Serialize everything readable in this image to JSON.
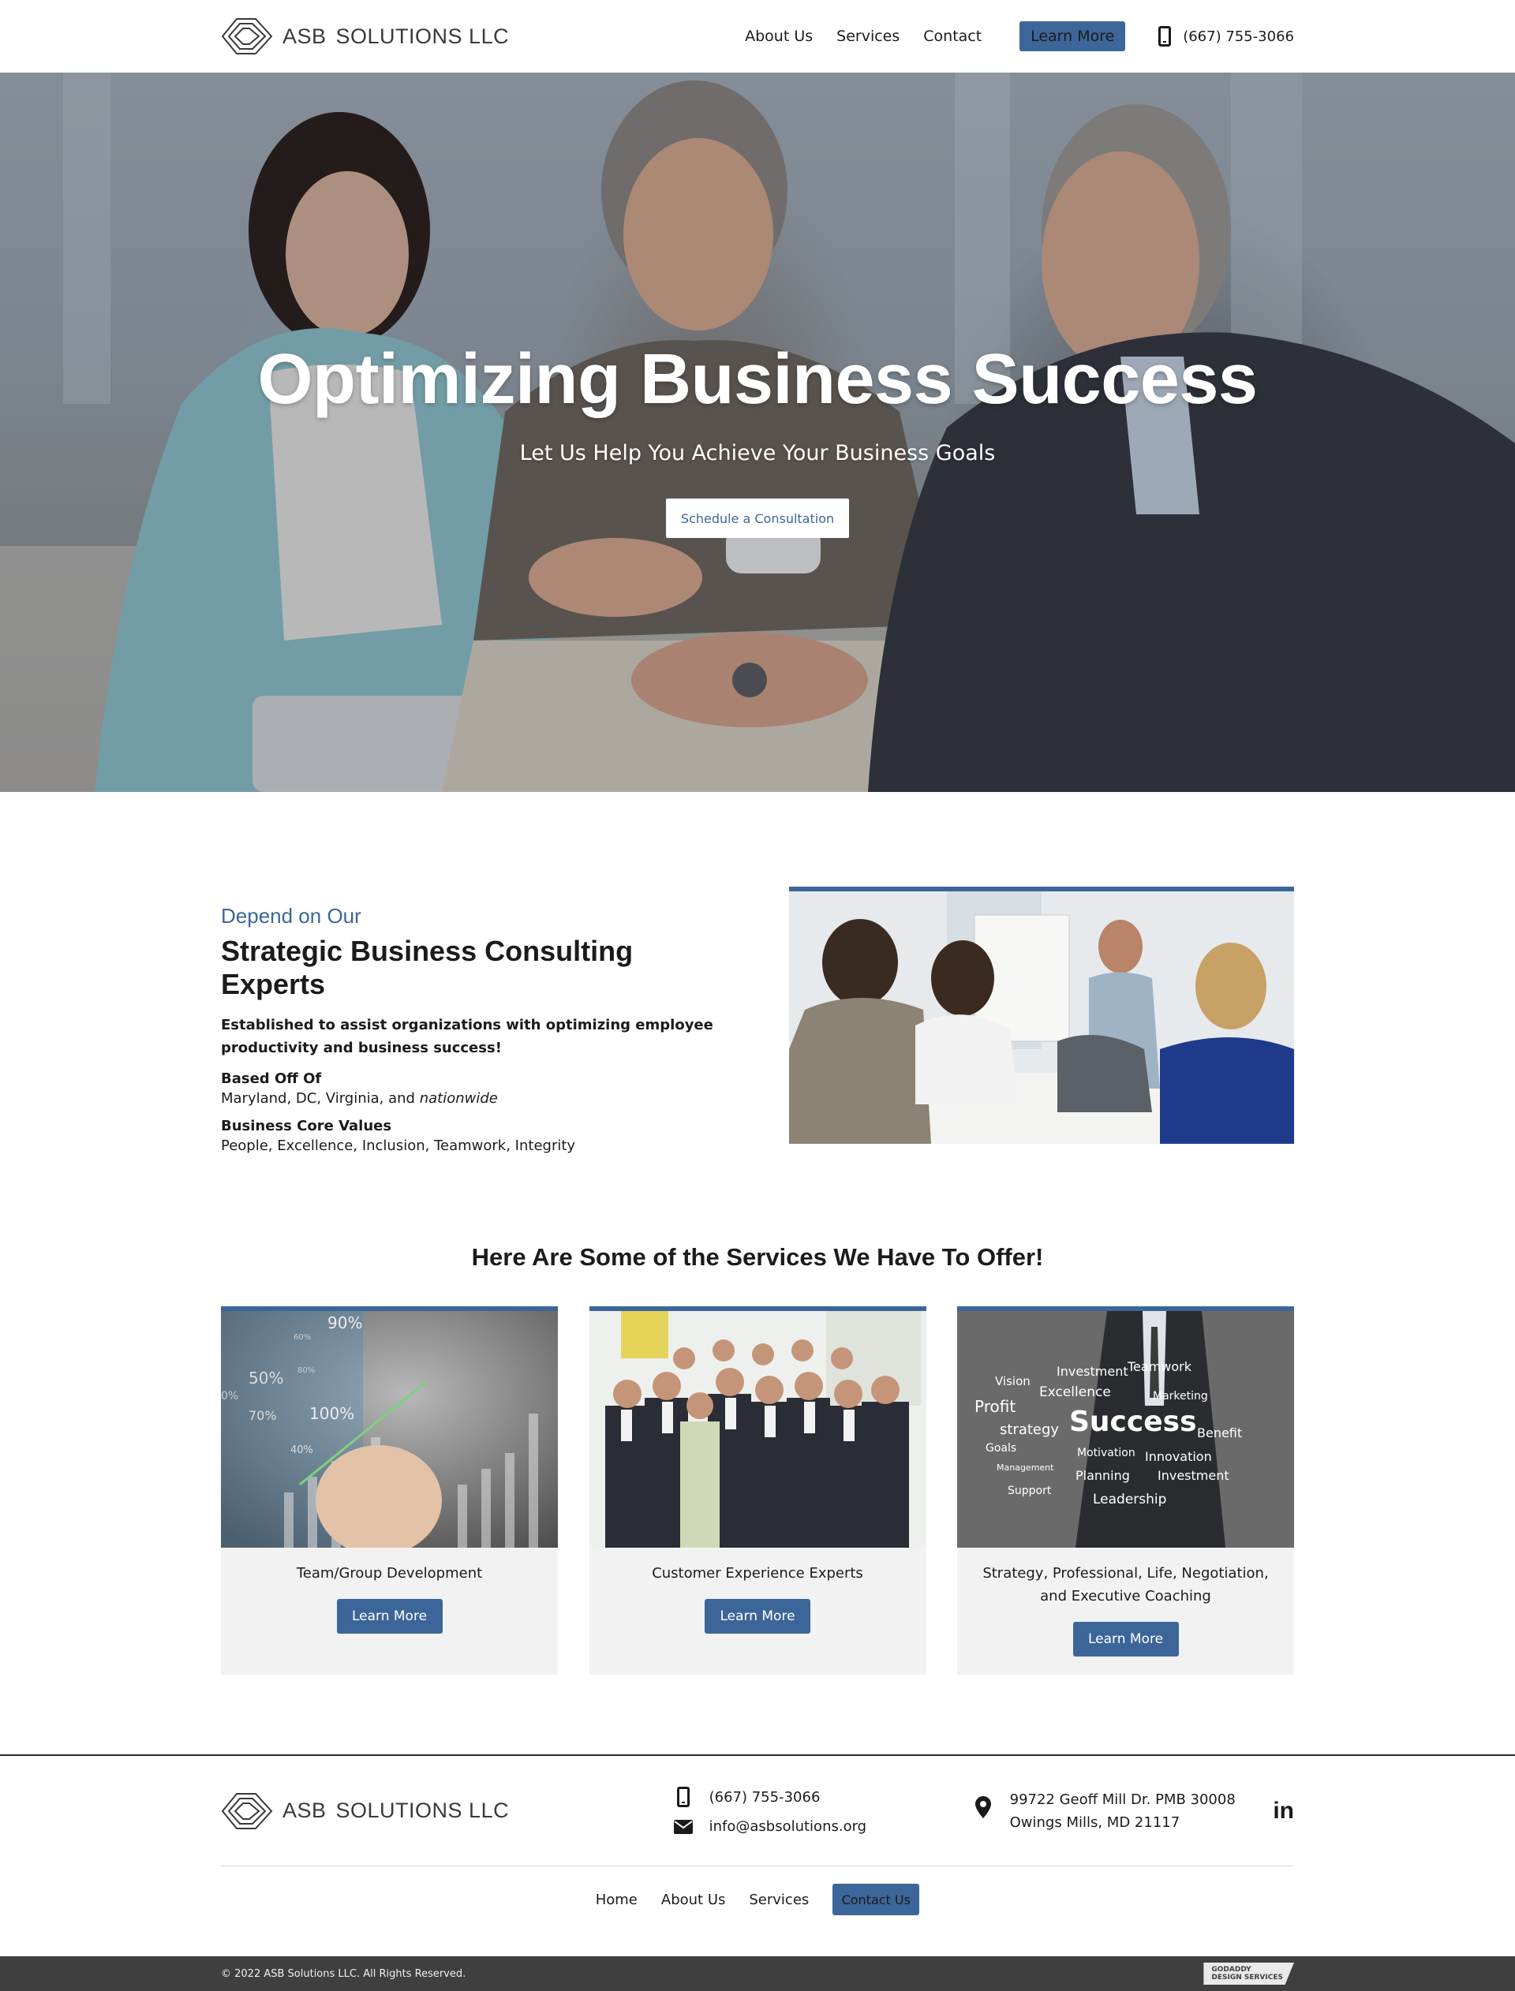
{
  "header": {
    "logo_text": "ASB",
    "logo_text2": "SOLUTIONS LLC",
    "nav": [
      "About Us",
      "Services",
      "Contact"
    ],
    "cta_label": "Learn More",
    "phone": "(667) 755-3066"
  },
  "hero": {
    "title": "Optimizing Business Success",
    "subtitle": "Let Us Help You Achieve Your Business Goals",
    "button": "Schedule a Consultation"
  },
  "about": {
    "eyebrow": "Depend on Our",
    "title": "Strategic Business Consulting Experts",
    "lead": "Established to assist organizations with optimizing employee productivity and business success!",
    "based_label": "Based Off Of",
    "based_value": "Maryland, DC, Virginia, and ",
    "based_value_italic": "nationwide",
    "values_label": "Business Core Values",
    "values_value": "People, Excellence, Inclusion, Teamwork, Integrity"
  },
  "services": {
    "heading": "Here Are Some of the Services We Have To Offer!",
    "cards": [
      {
        "title": "Team/Group Development",
        "button": "Learn More",
        "image_labels": [
          "90%",
          "50%",
          "70%",
          "100%",
          "40%",
          "60%",
          "80%",
          "0%"
        ]
      },
      {
        "title": "Customer Experience Experts",
        "button": "Learn More"
      },
      {
        "title": "Strategy, Professional, Life, Negotiation, and Executive Coaching",
        "button": "Learn More",
        "image_words": [
          "Vision",
          "Investment",
          "Teamwork",
          "Excellence",
          "Profit",
          "Marketing",
          "Success",
          "strategy",
          "Benefit",
          "Goals",
          "Motivation",
          "Innovation",
          "Management",
          "Planning",
          "Investment",
          "Support",
          "Leadership"
        ]
      }
    ]
  },
  "footer": {
    "logo_text": "ASB",
    "logo_text2": "SOLUTIONS LLC",
    "phone": "(667) 755-3066",
    "email": "info@asbsolutions.org",
    "address_line1": "99722 Geoff Mill Dr. PMB 30008",
    "address_line2": "Owings Mills, MD 21117",
    "social": "in",
    "nav": [
      "Home",
      "About Us",
      "Services"
    ],
    "contact_button": "Contact Us",
    "copyright": "© 2022 ASB Solutions LLC. All Rights Reserved.",
    "badge_line1": "GODADDY",
    "badge_line2": "DESIGN SERVICES"
  },
  "colors": {
    "accent": "#3c6699",
    "card_bg": "#f2f2f2",
    "footer_bar": "#3f3f3f"
  },
  "icons": [
    "logo-mark-icon",
    "phone-icon",
    "envelope-icon",
    "map-pin-icon",
    "linkedin-icon"
  ]
}
